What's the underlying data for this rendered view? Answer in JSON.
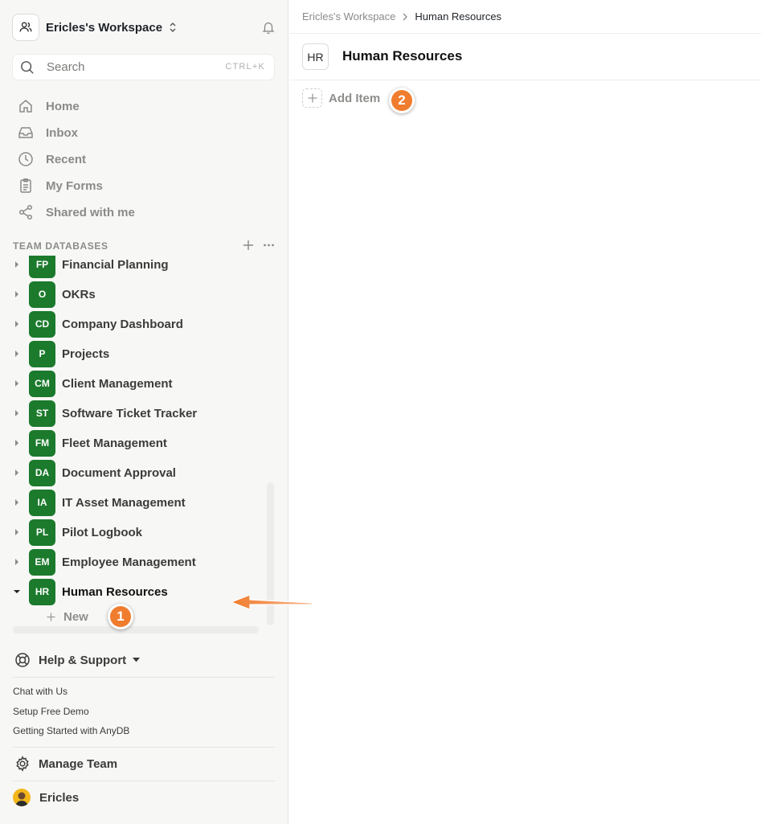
{
  "workspace": {
    "name": "Ericles's Workspace"
  },
  "search": {
    "placeholder": "Search",
    "shortcut": "CTRL+K"
  },
  "nav": [
    {
      "label": "Home",
      "icon": "home-icon"
    },
    {
      "label": "Inbox",
      "icon": "inbox-icon"
    },
    {
      "label": "Recent",
      "icon": "clock-icon"
    },
    {
      "label": "My Forms",
      "icon": "clipboard-icon"
    },
    {
      "label": "Shared with me",
      "icon": "share-icon"
    }
  ],
  "team_databases": {
    "label": "TEAM DATABASES",
    "items": [
      {
        "badge": "FP",
        "label": "Financial Planning"
      },
      {
        "badge": "O",
        "label": "OKRs"
      },
      {
        "badge": "CD",
        "label": "Company Dashboard"
      },
      {
        "badge": "P",
        "label": "Projects"
      },
      {
        "badge": "CM",
        "label": "Client Management"
      },
      {
        "badge": "ST",
        "label": "Software Ticket Tracker"
      },
      {
        "badge": "FM",
        "label": "Fleet Management"
      },
      {
        "badge": "DA",
        "label": "Document Approval"
      },
      {
        "badge": "IA",
        "label": "IT Asset Management"
      },
      {
        "badge": "PL",
        "label": "Pilot Logbook"
      },
      {
        "badge": "EM",
        "label": "Employee Management"
      },
      {
        "badge": "HR",
        "label": "Human Resources"
      }
    ],
    "new_label": "New",
    "badge_color": "#1b7a2c"
  },
  "help": {
    "label": "Help & Support",
    "links": [
      "Chat with Us",
      "Setup Free Demo",
      "Getting Started with AnyDB"
    ]
  },
  "manage_team": {
    "label": "Manage Team"
  },
  "user": {
    "name": "Ericles"
  },
  "breadcrumb": {
    "workspace": "Ericles's Workspace",
    "current": "Human Resources"
  },
  "page": {
    "icon_text": "HR",
    "title": "Human Resources",
    "add_item_label": "Add Item"
  },
  "annotations": {
    "marker_1": "1",
    "marker_2": "2",
    "accent": "#f07c2e"
  }
}
